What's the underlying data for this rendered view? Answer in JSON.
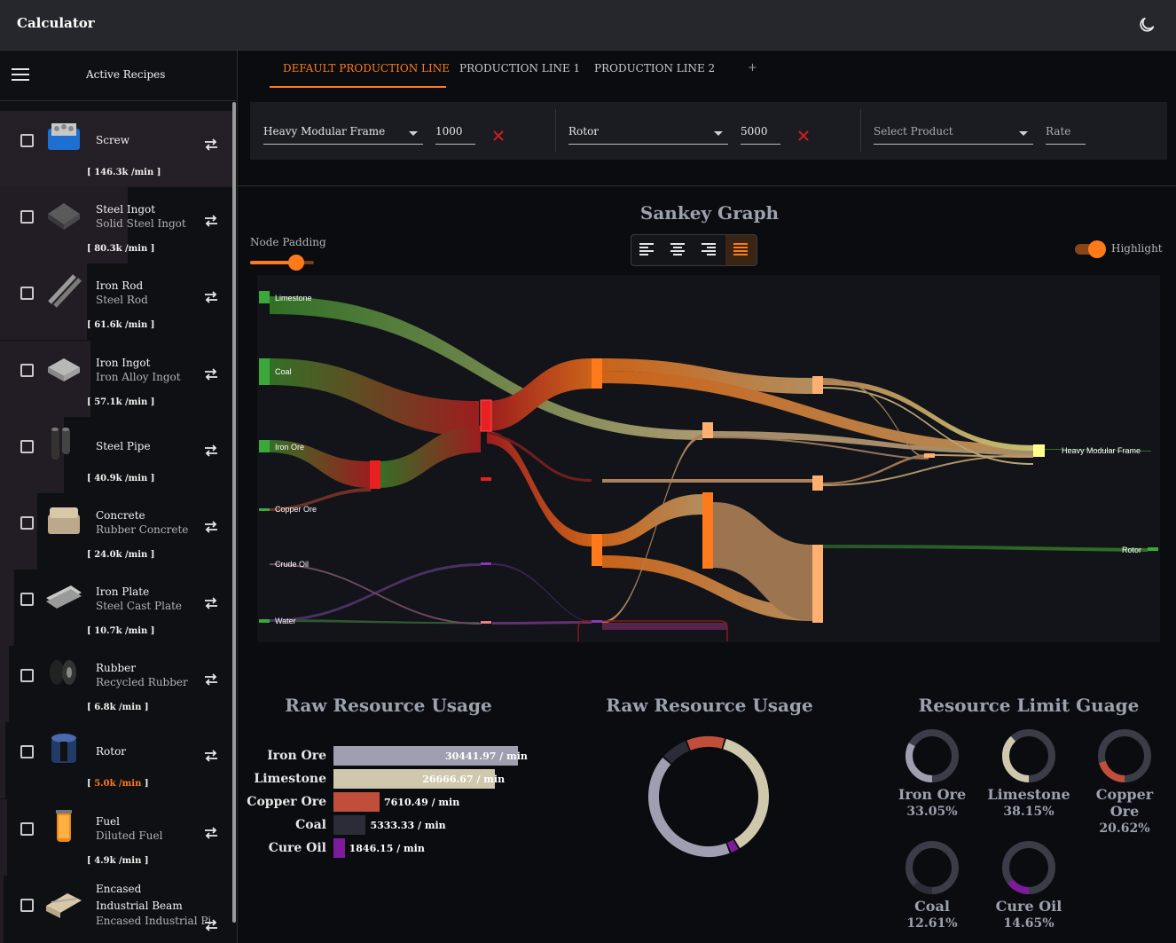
{
  "app": {
    "title": "Calculator"
  },
  "sidebar": {
    "title": "Active Recipes",
    "recipes": [
      {
        "name": "Screw",
        "alt": "",
        "rate": "146.3k",
        "unit": "/min",
        "highlight": false
      },
      {
        "name": "Steel Ingot",
        "alt": "Solid Steel Ingot",
        "rate": "80.3k",
        "unit": "/min",
        "highlight": false
      },
      {
        "name": "Iron Rod",
        "alt": "Steel Rod",
        "rate": "61.6k",
        "unit": "/min",
        "highlight": false
      },
      {
        "name": "Iron Ingot",
        "alt": "Iron Alloy Ingot",
        "rate": "57.1k",
        "unit": "/min",
        "highlight": false
      },
      {
        "name": "Steel Pipe",
        "alt": "",
        "rate": "40.9k",
        "unit": "/min",
        "highlight": false
      },
      {
        "name": "Concrete",
        "alt": "Rubber Concrete",
        "rate": "24.0k",
        "unit": "/min",
        "highlight": false
      },
      {
        "name": "Iron Plate",
        "alt": "Steel Cast Plate",
        "rate": "10.7k",
        "unit": "/min",
        "highlight": false
      },
      {
        "name": "Rubber",
        "alt": "Recycled Rubber",
        "rate": "6.8k",
        "unit": "/min",
        "highlight": false
      },
      {
        "name": "Rotor",
        "alt": "",
        "rate": "5.0k",
        "unit": "/min",
        "highlight": true
      },
      {
        "name": "Fuel",
        "alt": "Diluted Fuel",
        "rate": "4.9k",
        "unit": "/min",
        "highlight": false
      },
      {
        "name": "Encased Industrial Beam",
        "alt": "Encased Industrial Pi",
        "rate": "",
        "unit": "",
        "highlight": false
      }
    ]
  },
  "tabs": [
    {
      "label": "DEFAULT PRODUCTION LINE",
      "active": true
    },
    {
      "label": "PRODUCTION LINE 1",
      "active": false
    },
    {
      "label": "PRODUCTION LINE 2",
      "active": false
    }
  ],
  "tab_add": "+",
  "products": [
    {
      "product": "Heavy Modular Frame",
      "rate": "1000"
    },
    {
      "product": "Rotor",
      "rate": "5000"
    },
    {
      "product_placeholder": "Select Product",
      "rate_placeholder": "Rate"
    }
  ],
  "sankey": {
    "title": "Sankey Graph",
    "node_padding_label": "Node Padding",
    "node_padding_value": 0.72,
    "alignment": [
      "justify-left",
      "justify-center",
      "justify-right",
      "justify-full"
    ],
    "active_alignment": "justify-full",
    "highlight_label": "Highlight",
    "highlight_on": true,
    "nodes": {
      "limestone": "Limestone",
      "coal": "Coal",
      "iron_ore": "Iron Ore",
      "copper_ore": "Copper Ore",
      "crude_oil": "Crude Oil",
      "water": "Water",
      "hmf": "Heavy Modular Frame",
      "rotor": "Rotor"
    }
  },
  "raw_bar": {
    "title": "Raw Resource Usage",
    "items": [
      {
        "label": "Iron Ore",
        "value": 30441.97,
        "text": "30441.97 / min",
        "color": "#a09eb1"
      },
      {
        "label": "Limestone",
        "value": 26666.67,
        "text": "26666.67 / min",
        "color": "#cfc8ad"
      },
      {
        "label": "Copper Ore",
        "value": 7610.49,
        "text": "7610.49 / min",
        "color": "#c04e3b"
      },
      {
        "label": "Coal",
        "value": 5333.33,
        "text": "5333.33 / min",
        "color": "#2c2c39"
      },
      {
        "label": "Cure Oil",
        "value": 1846.15,
        "text": "1846.15 / min",
        "color": "#7d1b9c"
      }
    ]
  },
  "raw_donut": {
    "title": "Raw Resource Usage"
  },
  "gauge": {
    "title": "Resource Limit Guage",
    "items": [
      {
        "label": "Iron Ore",
        "pct_text": "33.05%",
        "value": 0.3305,
        "color": "#a09eb1"
      },
      {
        "label": "Limestone",
        "pct_text": "38.15%",
        "value": 0.3815,
        "color": "#cfc8ad"
      },
      {
        "label": "Copper Ore",
        "pct_text": "20.62%",
        "value": 0.2062,
        "color": "#c04e3b"
      },
      {
        "label": "Coal",
        "pct_text": "12.61%",
        "value": 0.1261,
        "color": "#2c2c39"
      },
      {
        "label": "Cure Oil",
        "pct_text": "14.65%",
        "value": 0.1465,
        "color": "#7d1b9c"
      }
    ]
  }
}
